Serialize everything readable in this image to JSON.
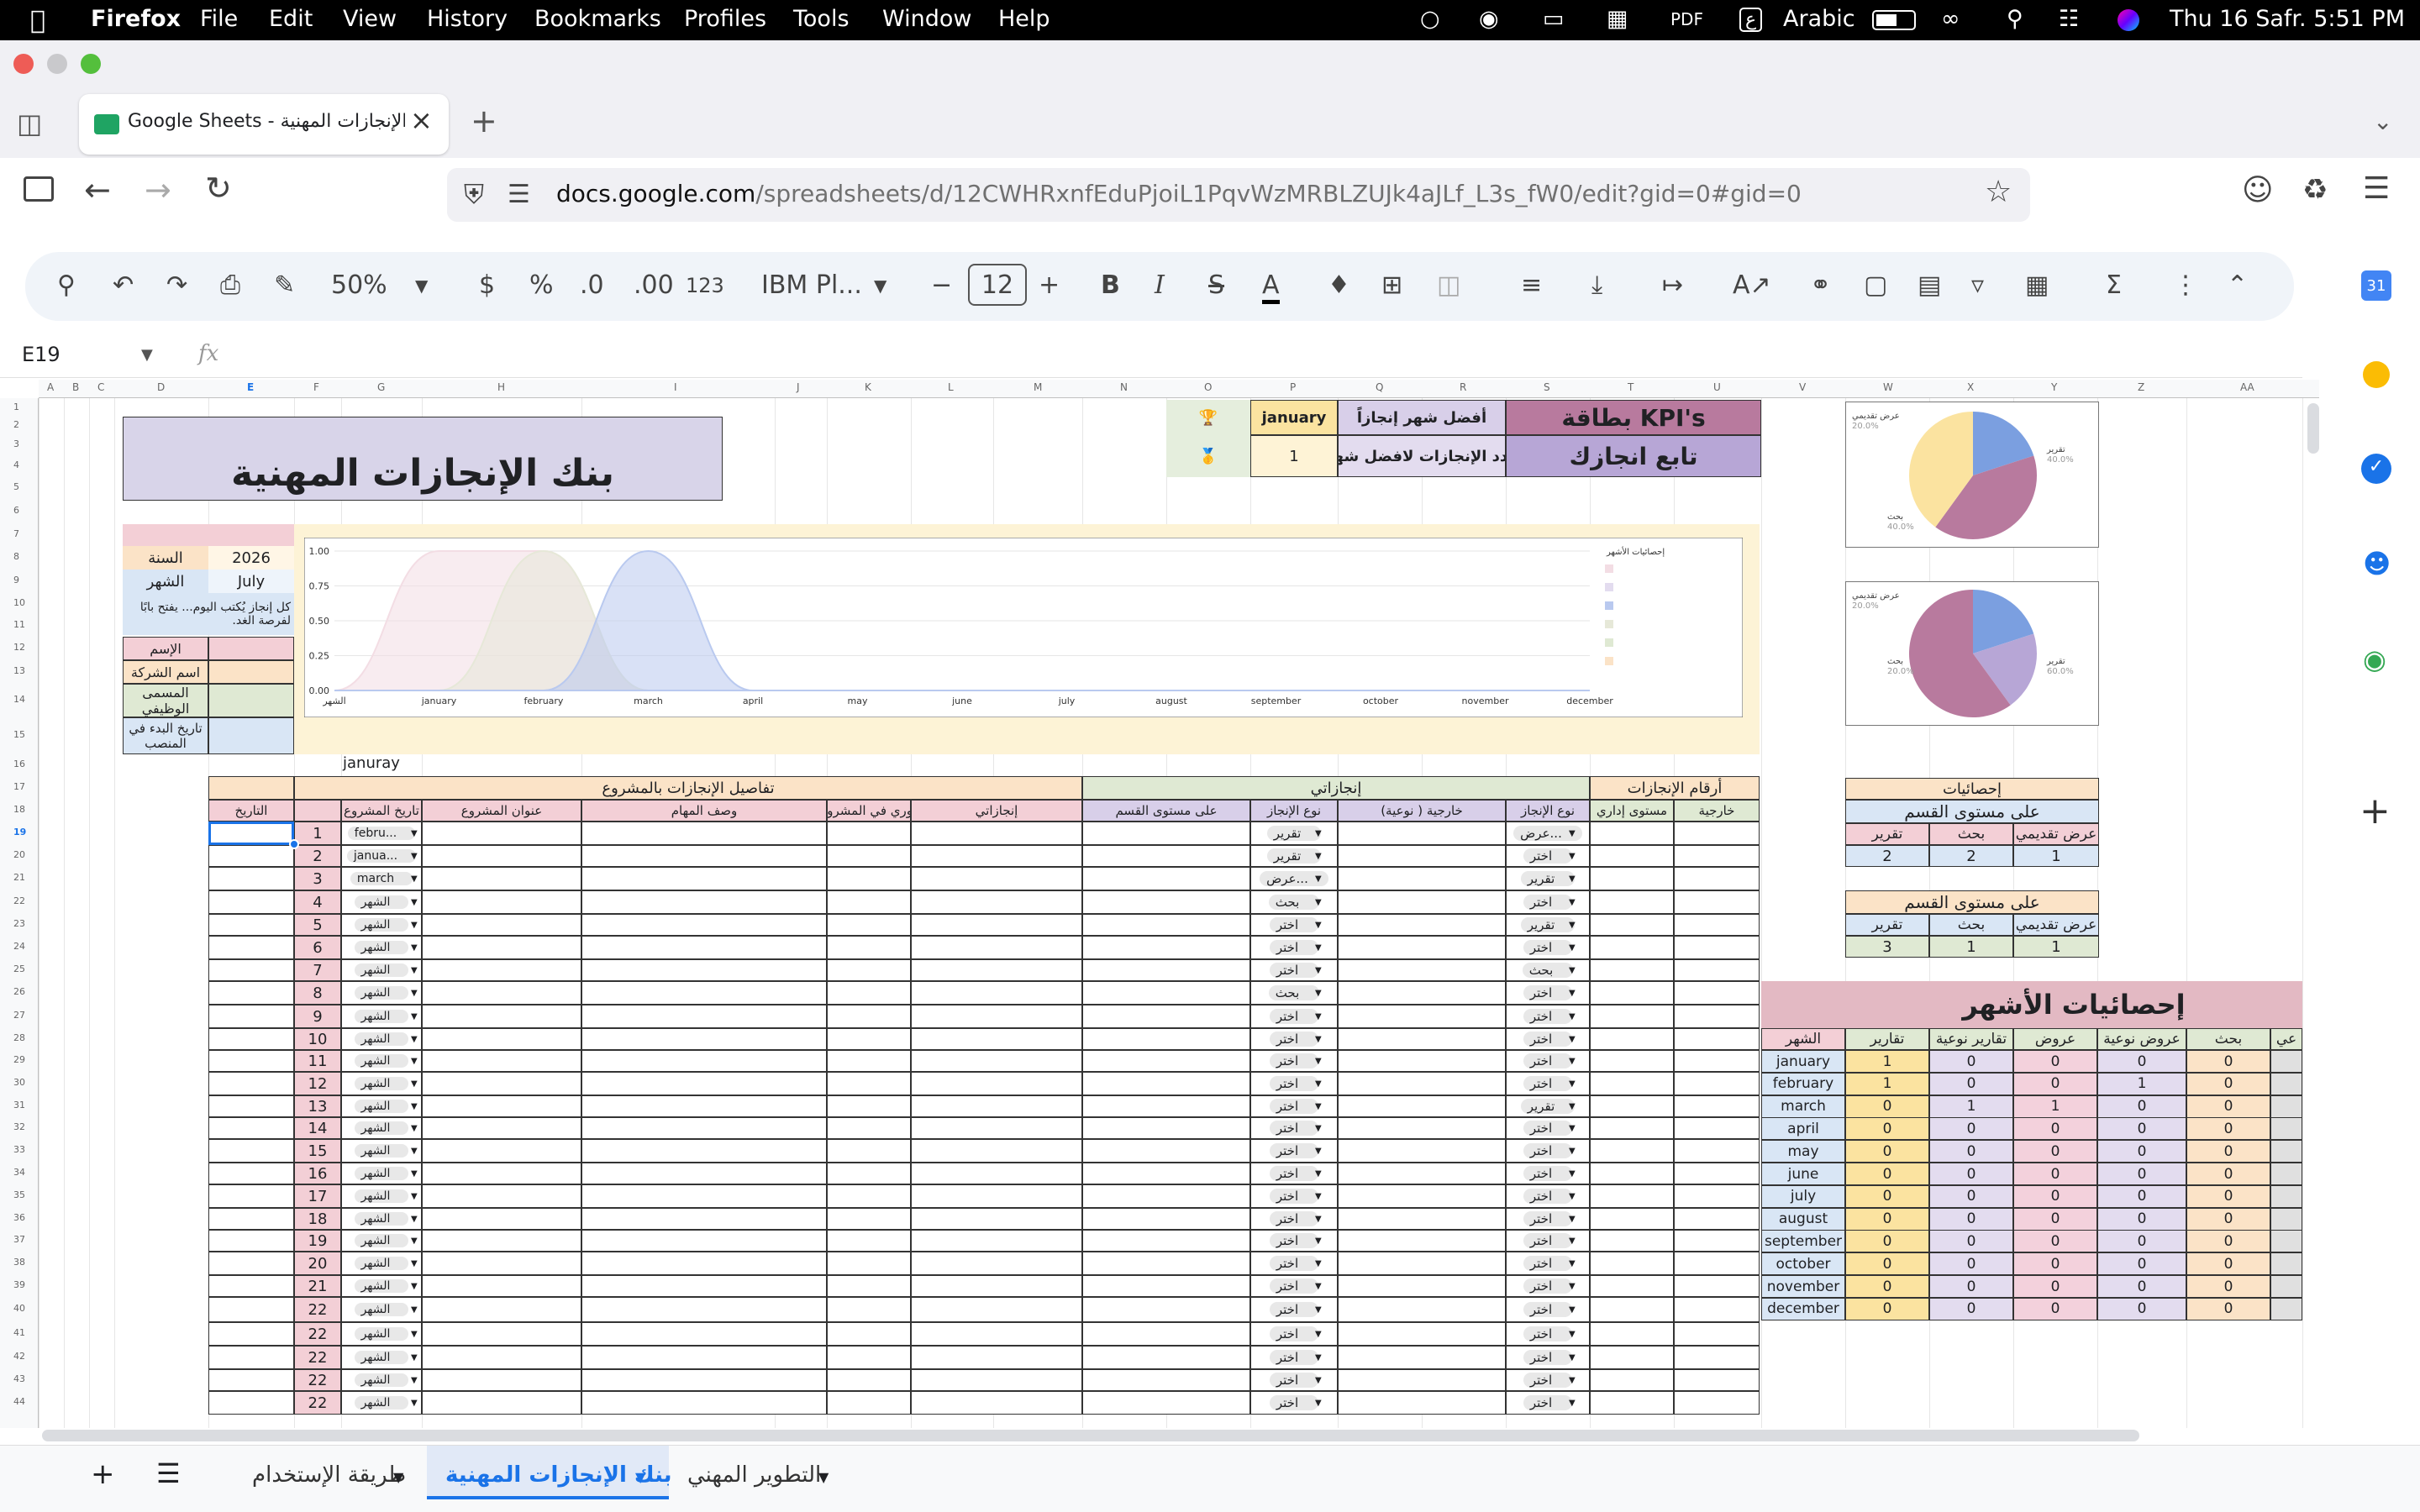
{
  "menubar": {
    "app": "Firefox",
    "items": [
      "File",
      "Edit",
      "View",
      "History",
      "Bookmarks",
      "Profiles",
      "Tools",
      "Window",
      "Help"
    ],
    "input_source": "Arabic",
    "clock": "Thu 16 Safr.  5:51 PM"
  },
  "browser": {
    "tab_title": "Google Sheets - بنك الإنجازات المهنية",
    "url_host": "docs.google.com",
    "url_path": "/spreadsheets/d/12CWHRxnfEduPjoiL1PqvWzMRBLZUJk4aJLf_L3s_fW0/edit?gid=0#gid=0"
  },
  "toolbar": {
    "zoom": "50%",
    "currency": "$",
    "percent": "%",
    "dec_dec": ".0",
    "inc_dec": ".00",
    "format_123": "123",
    "font": "IBM Pl...",
    "font_size": "12"
  },
  "formula": {
    "cell_ref": "E19",
    "fx": "fx"
  },
  "columns": [
    "A",
    "B",
    "C",
    "D",
    "E",
    "F",
    "G",
    "H",
    "I",
    "J",
    "K",
    "L",
    "M",
    "N",
    "O",
    "P",
    "Q",
    "R",
    "S",
    "T",
    "U",
    "V",
    "W",
    "X",
    "Y",
    "Z",
    "AA"
  ],
  "rows": [
    "1",
    "2",
    "3",
    "4",
    "5",
    "6",
    "7",
    "8",
    "9",
    "10",
    "11",
    "12",
    "13",
    "14",
    "15",
    "16",
    "17",
    "18",
    "19",
    "20",
    "21",
    "22",
    "23",
    "24",
    "25",
    "26",
    "27",
    "28",
    "29",
    "30",
    "31",
    "32",
    "33",
    "34",
    "35",
    "36",
    "37",
    "38",
    "39",
    "40",
    "41",
    "42",
    "43",
    "44"
  ],
  "sheet": {
    "title": "بنك الإنجازات المهنية",
    "kpi_title": "بطاقة KPI's",
    "kpi_sub": "تابع انجازك",
    "best_month_label": "أفضل شهر إنجازاً",
    "best_month_value": "january",
    "count_label": "عدد الإنجازات لافضل شهر",
    "count_value": "1",
    "trophy": "🏆",
    "medal": "🥇",
    "year_label": "السنة",
    "year_value": "2026",
    "month_label": "الشهر",
    "month_value": "July",
    "quote": "كل إنجاز يُكتب اليوم... يفتح بابًا لفرصة الغد.",
    "profile_fields": [
      "الإسم",
      "اسم الشركة",
      "المسمى الوظيفي",
      "تاريخ البدء في المنصب"
    ],
    "januray_label": "januray",
    "section_achievement_numbers": "أرقام الإنجازات",
    "section_achievements": "إنجازاتي",
    "section_details": "تفاصيل الإنجازات بالمشروع",
    "headers": [
      "خارجية",
      "مستوى إداري",
      "نوع الإنجاز",
      "خارجية ( نوعية)",
      "نوع الإنجاز",
      "على مستوى القسم",
      "إنجازاتي",
      "دوري في المشروع",
      "وصف المهام",
      "عنوان المشروع",
      "تاريخ المشروع",
      "التاريخ"
    ],
    "row_nums": [
      "1",
      "2",
      "3",
      "4",
      "5",
      "6",
      "7",
      "8",
      "9",
      "10",
      "11",
      "12",
      "13",
      "14",
      "15",
      "16",
      "17",
      "18",
      "19",
      "20",
      "21",
      "22",
      "22",
      "22",
      "22",
      "22"
    ],
    "type1": [
      "عرض...",
      "اختر",
      "تقرير",
      "اختر",
      "تقرير",
      "اختر",
      "بحث",
      "اختر",
      "اختر",
      "اختر",
      "اختر",
      "اختر",
      "تقرير",
      "اختر",
      "اختر",
      "اختر",
      "اختر",
      "اختر",
      "اختر",
      "اختر",
      "اختر",
      "اختر",
      "اختر",
      "اختر",
      "اختر",
      "اختر"
    ],
    "type2": [
      "تقرير",
      "تقرير",
      "عرض...",
      "بحث",
      "اختر",
      "اختر",
      "اختر",
      "بحث",
      "اختر",
      "اختر",
      "اختر",
      "اختر",
      "اختر",
      "اختر",
      "اختر",
      "اختر",
      "اختر",
      "اختر",
      "اختر",
      "اختر",
      "اختر",
      "اختر",
      "اختر",
      "اختر",
      "اختر",
      "اختر"
    ],
    "project_date": [
      "febru...",
      "janua...",
      "march",
      "الشهر",
      "الشهر",
      "الشهر",
      "الشهر",
      "الشهر",
      "الشهر",
      "الشهر",
      "الشهر",
      "الشهر",
      "الشهر",
      "الشهر",
      "الشهر",
      "الشهر",
      "الشهر",
      "الشهر",
      "الشهر",
      "الشهر",
      "الشهر",
      "الشهر",
      "الشهر",
      "الشهر",
      "الشهر",
      "الشهر"
    ]
  },
  "stats": {
    "title": "إحصائيات",
    "dept1": "على مستوى القسم",
    "dept2": "على مستوى القسم",
    "cols": [
      "عرض تقديمي",
      "بحث",
      "تقرير"
    ],
    "vals1": [
      "1",
      "2",
      "2"
    ],
    "vals2": [
      "1",
      "1",
      "3"
    ]
  },
  "monthly": {
    "title": "إحصائيات الأشهر",
    "headers": [
      "الشهر",
      "تقارير",
      "تقارير نوعية",
      "عروض",
      "عروض نوعية",
      "بحث",
      "عي"
    ],
    "months": [
      "january",
      "february",
      "march",
      "april",
      "may",
      "june",
      "july",
      "august",
      "september",
      "october",
      "november",
      "december"
    ],
    "values": [
      [
        "1",
        "0",
        "0",
        "0",
        "0"
      ],
      [
        "1",
        "0",
        "0",
        "1",
        "0"
      ],
      [
        "0",
        "1",
        "1",
        "0",
        "0"
      ],
      [
        "0",
        "0",
        "0",
        "0",
        "0"
      ],
      [
        "0",
        "0",
        "0",
        "0",
        "0"
      ],
      [
        "0",
        "0",
        "0",
        "0",
        "0"
      ],
      [
        "0",
        "0",
        "0",
        "0",
        "0"
      ],
      [
        "0",
        "0",
        "0",
        "0",
        "0"
      ],
      [
        "0",
        "0",
        "0",
        "0",
        "0"
      ],
      [
        "0",
        "0",
        "0",
        "0",
        "0"
      ],
      [
        "0",
        "0",
        "0",
        "0",
        "0"
      ],
      [
        "0",
        "0",
        "0",
        "0",
        "0"
      ]
    ]
  },
  "pie1": {
    "labels": [
      "عرض تقديمي",
      "تقرير",
      "بحث"
    ],
    "pcts": [
      "20.0%",
      "40.0%",
      "40.0%"
    ],
    "values": [
      20,
      40,
      40
    ],
    "colors": [
      "#7b9fe0",
      "#b87a9e",
      "#fbe3a0"
    ]
  },
  "pie2": {
    "labels": [
      "عرض تقديمي",
      "بحث",
      "تقرير"
    ],
    "pcts": [
      "20.0%",
      "20.0%",
      "60.0%"
    ],
    "values": [
      20,
      20,
      60
    ],
    "colors": [
      "#7b9fe0",
      "#b7a6d6",
      "#b87a9e"
    ]
  },
  "chart_data": {
    "type": "area",
    "categories": [
      "الشهر",
      "january",
      "february",
      "march",
      "april",
      "may",
      "june",
      "july",
      "august",
      "september",
      "october",
      "november",
      "december"
    ],
    "yticks": [
      "0.00",
      "0.25",
      "0.50",
      "0.75",
      "1.00"
    ],
    "ylim": [
      0,
      1
    ],
    "legend_title": "إحصائيات الأشهر",
    "series": [
      {
        "color": "#f3dde4",
        "values": [
          0,
          1,
          1,
          0,
          0,
          0,
          0,
          0,
          0,
          0,
          0,
          0,
          0
        ]
      },
      {
        "color": "#e6e8d8",
        "values": [
          0,
          0,
          1,
          0,
          0,
          0,
          0,
          0,
          0,
          0,
          0,
          0,
          0
        ]
      },
      {
        "color": "#b9c9ef",
        "values": [
          0,
          0,
          0,
          1,
          0,
          0,
          0,
          0,
          0,
          0,
          0,
          0,
          0
        ]
      }
    ]
  },
  "sheet_tabs": [
    "طريقة الإستخدام",
    "بنك الإنجازات المهنية",
    "التطوير المهني"
  ]
}
